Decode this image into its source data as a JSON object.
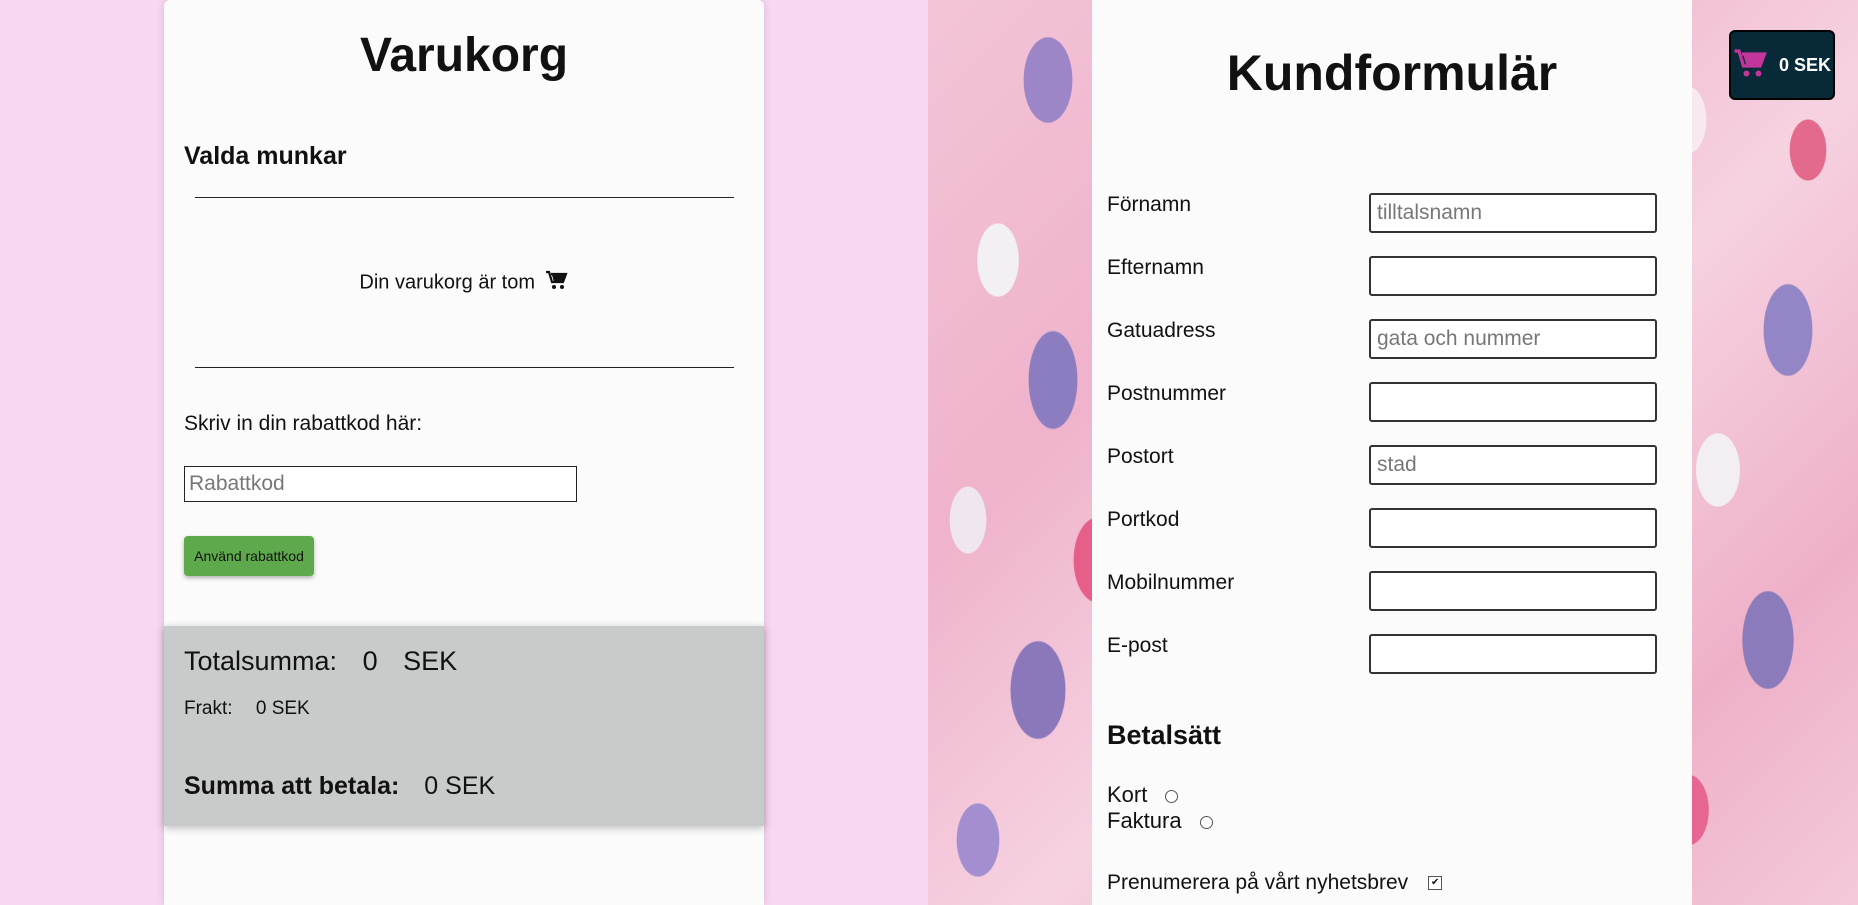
{
  "cart": {
    "title": "Varukorg",
    "selected_heading": "Valda munkar",
    "empty_message": "Din varukorg är tom",
    "discount_label": "Skriv in din rabattkod här:",
    "discount_placeholder": "Rabattkod",
    "discount_value": "",
    "apply_button": "Använd rabattkod",
    "total_label": "Totalsumma:",
    "total_value": "0",
    "total_currency": "SEK",
    "shipping_label": "Frakt:",
    "shipping_value": "0 SEK",
    "pay_label": "Summa att betala:",
    "pay_value": "0 SEK"
  },
  "form": {
    "title": "Kundformulär",
    "fields": [
      {
        "label": "Förnamn",
        "placeholder": "tilltalsnamn",
        "value": ""
      },
      {
        "label": "Efternamn",
        "placeholder": "",
        "value": ""
      },
      {
        "label": "Gatuadress",
        "placeholder": "gata och nummer",
        "value": ""
      },
      {
        "label": "Postnummer",
        "placeholder": "",
        "value": ""
      },
      {
        "label": "Postort",
        "placeholder": "stad",
        "value": ""
      },
      {
        "label": "Portkod",
        "placeholder": "",
        "value": ""
      },
      {
        "label": "Mobilnummer",
        "placeholder": "",
        "value": ""
      },
      {
        "label": "E-post",
        "placeholder": "",
        "value": ""
      }
    ],
    "payment_heading": "Betalsätt",
    "payment_options": [
      "Kort",
      "Faktura"
    ],
    "newsletter_label": "Prenumerera på vårt nyhetsbrev",
    "newsletter_checked": true
  },
  "cart_badge": {
    "amount": "0 SEK",
    "icon": "shopping-cart-icon",
    "icon_color": "#c2359a"
  },
  "colors": {
    "page_bg": "#f8d7f2",
    "apply_button_bg": "#5ea94b",
    "summary_bg": "#c9cbcb",
    "badge_bg": "#082a38"
  }
}
